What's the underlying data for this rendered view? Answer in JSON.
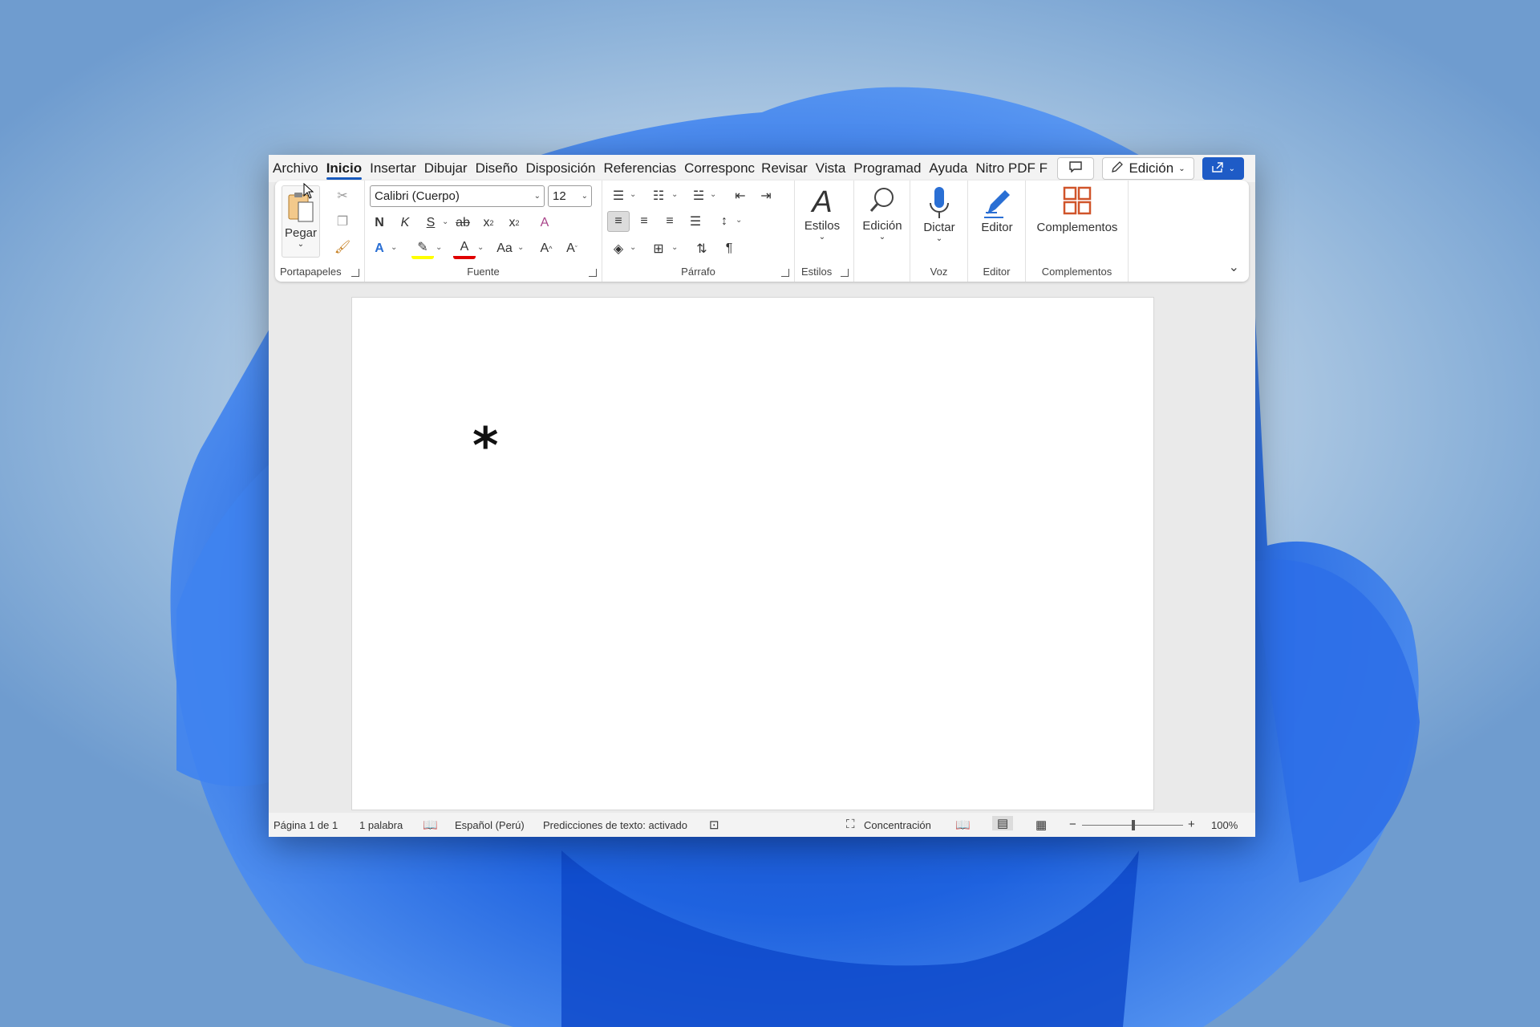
{
  "colors": {
    "accent": "#185abd",
    "share_button": "#1e5bc6",
    "wallpaper_bloom": "#1a5fe0"
  },
  "tabs": [
    "Archivo",
    "Inicio",
    "Insertar",
    "Dibujar",
    "Diseño",
    "Disposición",
    "Referencias",
    "Corresponc",
    "Revisar",
    "Vista",
    "Programad",
    "Ayuda",
    "Nitro PDF F"
  ],
  "active_tab": "Inicio",
  "edit_mode": "Edición",
  "clipboard": {
    "paste_label": "Pegar",
    "group_label": "Portapapeles"
  },
  "font": {
    "name": "Calibri (Cuerpo)",
    "size": "12",
    "group_label": "Fuente",
    "bold": "N",
    "italic": "K",
    "underline": "S",
    "strike": "ab",
    "case": "Aa"
  },
  "paragraph": {
    "group_label": "Párrafo",
    "pilcrow": "¶"
  },
  "styles": {
    "label": "Estilos",
    "group_label": "Estilos"
  },
  "editing": {
    "label": "Edición"
  },
  "voice": {
    "label": "Dictar",
    "group_label": "Voz"
  },
  "editor": {
    "label": "Editor",
    "group_label": "Editor"
  },
  "addins": {
    "label": "Complementos",
    "group_label": "Complementos"
  },
  "document": {
    "content": "*"
  },
  "status": {
    "page": "Página 1 de 1",
    "words": "1 palabra",
    "language": "Español (Perú)",
    "predictions": "Predicciones de texto: activado",
    "focus": "Concentración",
    "zoom": "100%",
    "zoom_minus": "−",
    "zoom_plus": "+"
  }
}
